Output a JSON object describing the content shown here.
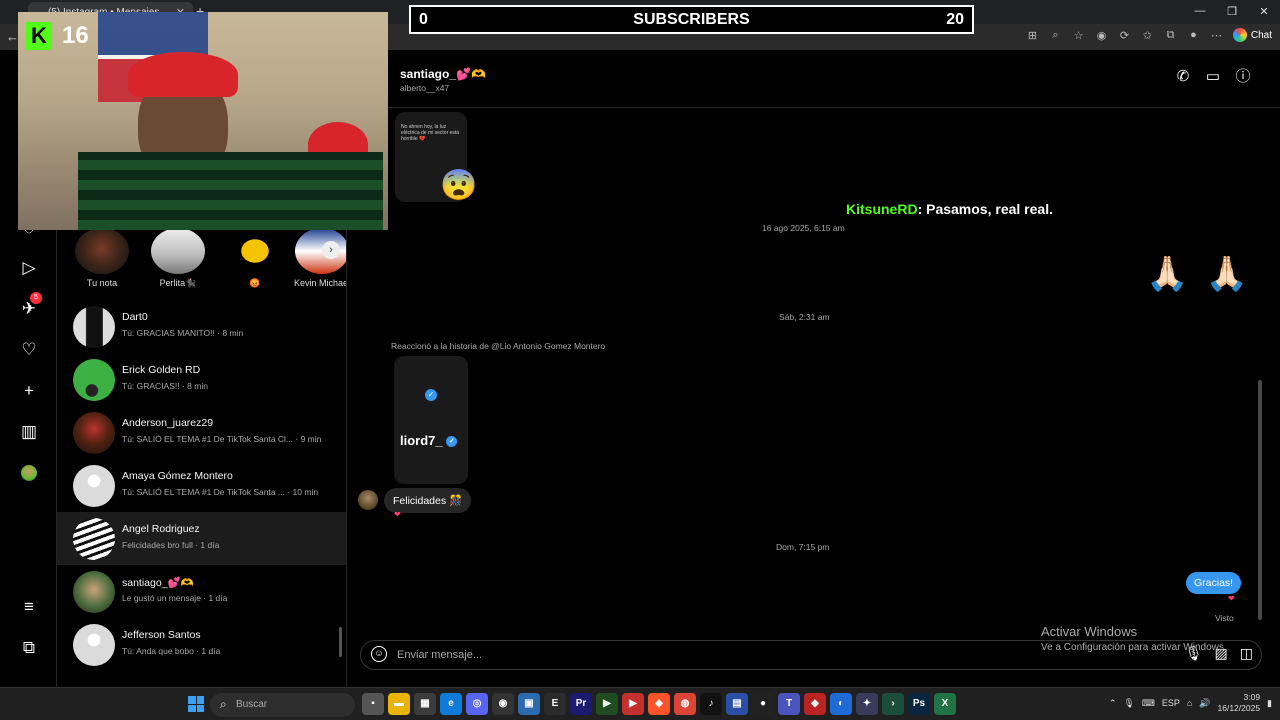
{
  "browser": {
    "tab_title": "(5) Instagram • Mensajes",
    "tab_close": "✕",
    "new_tab": "+",
    "chat_label": "Chat",
    "window_controls": [
      "—",
      "❐",
      "✕"
    ]
  },
  "overlay": {
    "subs_left": "0",
    "subs_label": "SUBSCRIBERS",
    "subs_right": "20",
    "kick_logo": "K",
    "kick_count": "16"
  },
  "rail": {
    "notif_count": "5"
  },
  "notes": [
    {
      "label": "Tu nota"
    },
    {
      "label": "Perlita🐈‍⬛"
    },
    {
      "label": "😡"
    },
    {
      "label": "Kevin Michael"
    }
  ],
  "conversations": [
    {
      "name": "Dart0",
      "preview": "Tú: GRACIAS MANITO!! · 8 min"
    },
    {
      "name": "Erick Golden RD",
      "preview": "Tú: GRACIAS!! · 8 min"
    },
    {
      "name": "Anderson_juarez29",
      "preview": "Tú: SALIÓ EL TEMA #1 De TikTok Santa Cl... · 9 min"
    },
    {
      "name": "Amaya Gómez Montero",
      "preview": "Tú: SALIÓ EL TEMA #1 De TikTok Santa ... · 10 min"
    },
    {
      "name": "Angel Rodriguez",
      "preview": "Felicidades bro full · 1 día"
    },
    {
      "name": "santiago_💕🫶",
      "preview": "Le gustó un mensaje · 1 día"
    },
    {
      "name": "Jefferson Santos",
      "preview": "Tú: Anda que bobo · 1 día"
    }
  ],
  "chat": {
    "name": "santiago_💕🫶",
    "username": "alberto__x47",
    "story_caption": "No ahnen hoy, la luz eléctrica de mi sector está horrible 💔",
    "story_emoji": "😨",
    "kitsune_user": "KitsuneRD",
    "kitsune_msg": ": Pasamos, real real.",
    "ts1": "16 ago 2025, 6:15 am",
    "reaction_emojis": "🙏🏻  🙏🏻",
    "ts2": "Sáb, 2:31 am",
    "story_reply_label": "Reaccionó a la historia de @Lio Antonio Gomez Montero",
    "story_user": "liord7_",
    "incoming": "Felicidades 🎊",
    "ts3": "Dom, 7:15 pm",
    "outgoing": "Gracias!",
    "heart": "❤",
    "seen": "Visto",
    "composer_placeholder": "Enviar mensaje..."
  },
  "watermark": {
    "line1": "Activar Windows",
    "line2": "Ve a Configuración para activar Windows."
  },
  "taskbar": {
    "search_placeholder": "Buscar",
    "lang": "ESP",
    "time": "3:09",
    "date": "16/12/2025"
  }
}
